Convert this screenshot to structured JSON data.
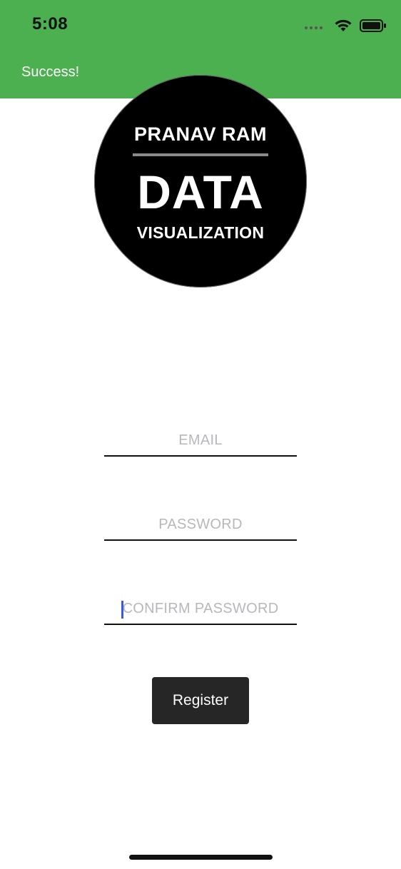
{
  "status_bar": {
    "time": "5:08",
    "icons": [
      "signal-dots-icon",
      "wifi-icon",
      "battery-icon"
    ]
  },
  "banner": {
    "message": "Success!",
    "color": "#4caf50"
  },
  "logo": {
    "line1": "PRANAV RAM",
    "line2": "DATA",
    "line3": "VISUALIZATION"
  },
  "form": {
    "email_placeholder": "EMAIL",
    "password_placeholder": "PASSWORD",
    "confirm_password_placeholder": "CONFIRM PASSWORD",
    "register_label": "Register"
  },
  "colors": {
    "accent": "#4caf50",
    "button": "#262626",
    "caret": "#3b5bdb"
  }
}
